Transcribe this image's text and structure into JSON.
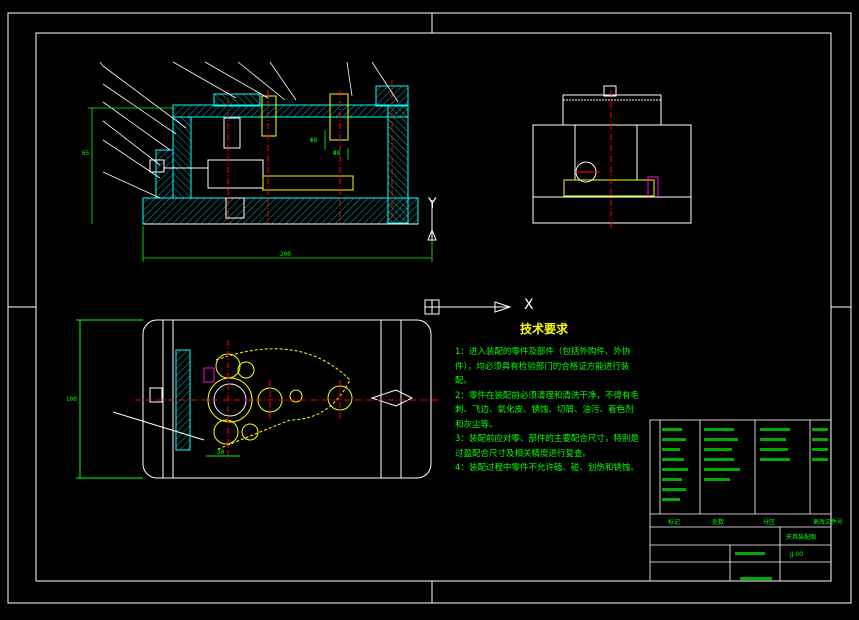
{
  "drawing": {
    "tech_requirements": {
      "title": "技术要求",
      "items": [
        "1：进入装配的零件及部件（包括外购件、外协件），均必须具有检验部门的合格证方能进行装配。",
        "2：零件在装配前必须清理和清洗干净，不得有毛刺、飞边、氧化皮、锈蚀、切屑、油污、着色剂和灰尘等。",
        "3：装配前应对零、部件的主要配合尺寸，特别是过盈配合尺寸及相关精度进行复查。",
        "4：装配过程中零件不允许磕、碰、划伤和锈蚀。"
      ]
    },
    "axis_labels": {
      "x": "X",
      "y": "Y"
    },
    "dimensions": {
      "front_height": "65",
      "front_width": "200",
      "top_height": "100",
      "bottom_dim": "30",
      "inner_dim_1": "Φ8",
      "inner_dim_2": "Φ8"
    },
    "title_block": {
      "col_labels": [
        "标记",
        "处数",
        "分区",
        "更改文件号"
      ],
      "drawing_name": "夹具装配图",
      "drawing_code": "JJ-00"
    },
    "colors": {
      "background": "#000000",
      "frame": "#ffffff",
      "part": "#00ff00",
      "hatch": "#00ffff",
      "dimension": "#00ff00",
      "center": "#ff0000",
      "highlight": "#ffff00",
      "accent": "#ff00ff"
    }
  }
}
